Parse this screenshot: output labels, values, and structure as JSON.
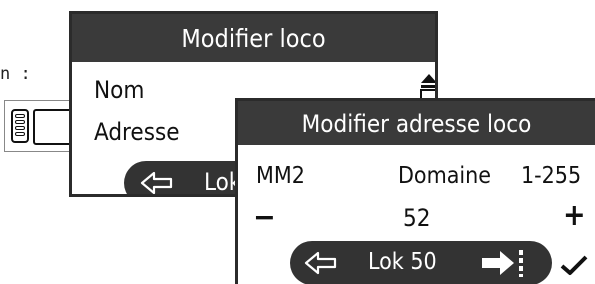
{
  "side_label": "n :",
  "screen1": {
    "title": "Modifier loco",
    "rows": [
      {
        "label": "Nom",
        "icon": "scroll-icon"
      },
      {
        "label": "Adresse"
      }
    ],
    "nav_label": "Lok"
  },
  "screen2": {
    "title": "Modifier adresse loco",
    "protocol": "MM2",
    "range_label": "Domaine",
    "range_value": "1-255",
    "minus": "−",
    "address_value": "52",
    "plus": "+",
    "nav_label": "Lok 50",
    "confirm_icon": "check-icon"
  }
}
